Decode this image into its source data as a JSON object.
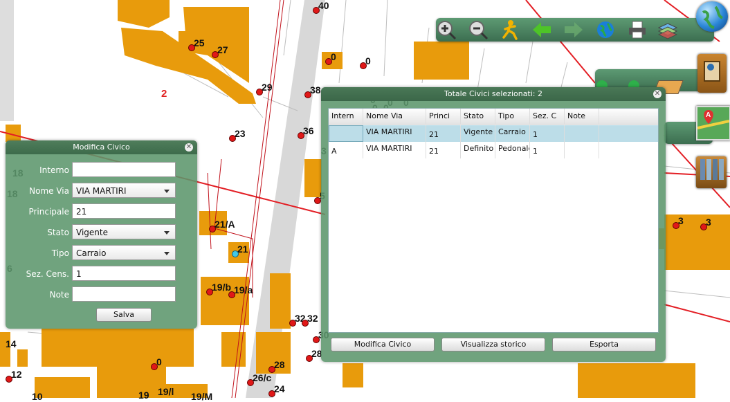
{
  "map": {
    "labels": [
      "40",
      "25",
      "27",
      "0",
      "0",
      "29",
      "38",
      "2",
      "23",
      "36",
      "3",
      "18",
      "18",
      "5",
      "21/A",
      "21",
      "3",
      "3",
      "19/b",
      "19/a",
      "32",
      "32",
      "30",
      "28",
      "0",
      "28",
      "26/c",
      "24",
      "14",
      "12",
      "10",
      "19",
      "19/l",
      "19/M",
      "6",
      "0",
      "0",
      "0",
      "0",
      "0",
      "0"
    ]
  },
  "toolbar": {
    "icons": [
      "zoom-in",
      "zoom-out",
      "pan",
      "back",
      "forward",
      "globe",
      "print",
      "layers"
    ]
  },
  "modifica_civico": {
    "title": "Modifica Civico",
    "fields": {
      "interno": {
        "label": "Interno",
        "value": ""
      },
      "nome_via": {
        "label": "Nome Via",
        "value": "VIA MARTIRI"
      },
      "principale": {
        "label": "Principale",
        "value": "21"
      },
      "stato": {
        "label": "Stato",
        "value": "Vigente"
      },
      "tipo": {
        "label": "Tipo",
        "value": "Carraio"
      },
      "sez_cens": {
        "label": "Sez. Cens.",
        "value": "1"
      },
      "note": {
        "label": "Note",
        "value": ""
      }
    },
    "save_label": "Salva"
  },
  "civici_panel": {
    "title": "Totale Civici selezionati: 2",
    "columns": [
      "Intern",
      "Nome Via",
      "Princi",
      "Stato",
      "Tipo",
      "Sez. C",
      "Note"
    ],
    "rows": [
      {
        "interno": "",
        "nome_via": "VIA MARTIRI",
        "principale": "21",
        "stato": "Vigente",
        "tipo": "Carraio",
        "sez": "1",
        "note": ""
      },
      {
        "interno": "A",
        "nome_via": "VIA MARTIRI",
        "principale": "21",
        "stato": "Definito",
        "tipo": "Pedonale",
        "sez": "1",
        "note": ""
      }
    ],
    "buttons": {
      "modifica": "Modifica Civico",
      "storico": "Visualizza storico",
      "esporta": "Esporta"
    }
  },
  "colors": {
    "building": "#e89b0c",
    "parcel_line": "#e31e24",
    "panel_green": "#5c966c",
    "selected_row": "#bcdde8"
  }
}
